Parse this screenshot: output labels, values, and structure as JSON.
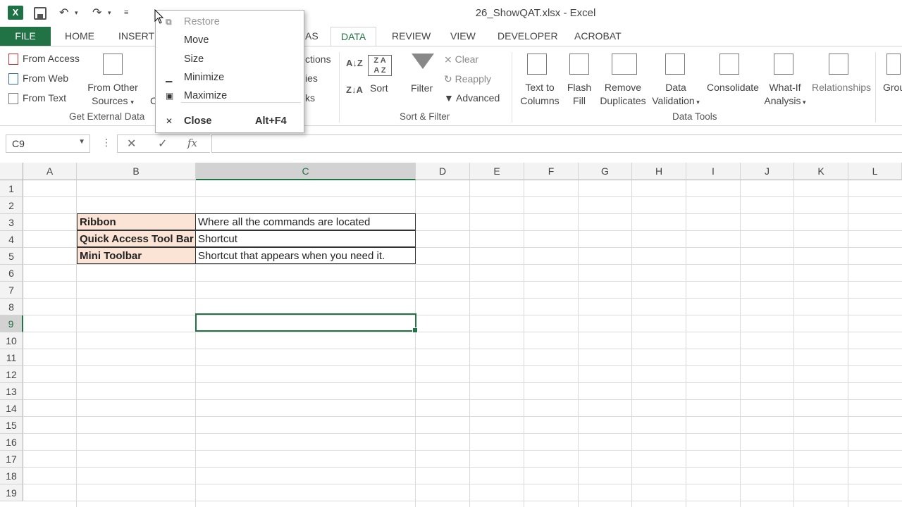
{
  "window": {
    "title": "26_ShowQAT.xlsx - Excel",
    "app_icon": "X"
  },
  "tabs": [
    {
      "label": "FILE"
    },
    {
      "label": "HOME"
    },
    {
      "label": "INSERT"
    },
    {
      "label": "AS"
    },
    {
      "label": "DATA"
    },
    {
      "label": "REVIEW"
    },
    {
      "label": "VIEW"
    },
    {
      "label": "DEVELOPER"
    },
    {
      "label": "ACROBAT"
    }
  ],
  "ribbon": {
    "get_external": {
      "from_access": "From Access",
      "from_web": "From Web",
      "from_text": "From Text",
      "from_other_1": "From Other",
      "from_other_2": "Sources",
      "partial_c": "C",
      "label": "Get External Data"
    },
    "connections": {
      "partial_1": "ctions",
      "partial_2": "ies",
      "partial_3": "ks"
    },
    "sort_filter": {
      "sort": "Sort",
      "filter": "Filter",
      "clear": "Clear",
      "reapply": "Reapply",
      "advanced": "Advanced",
      "label": "Sort & Filter"
    },
    "data_tools": {
      "text_to_1": "Text to",
      "text_to_2": "Columns",
      "flash_1": "Flash",
      "flash_2": "Fill",
      "remove_1": "Remove",
      "remove_2": "Duplicates",
      "validation_1": "Data",
      "validation_2": "Validation",
      "consolidate": "Consolidate",
      "whatif_1": "What-If",
      "whatif_2": "Analysis",
      "relationships": "Relationships",
      "group_partial": "Grou",
      "label": "Data Tools"
    }
  },
  "formula_bar": {
    "name_box": "C9",
    "cancel_glyph": "✕",
    "enter_glyph": "✓",
    "fx": "fx"
  },
  "columns": [
    "A",
    "B",
    "C",
    "D",
    "E",
    "F",
    "G",
    "H",
    "I",
    "J",
    "K",
    "L"
  ],
  "rows": [
    "1",
    "2",
    "3",
    "4",
    "5",
    "6",
    "7",
    "8",
    "9",
    "10",
    "11",
    "12",
    "13",
    "14",
    "15",
    "16",
    "17",
    "18",
    "19"
  ],
  "cells": [
    {
      "label": "Ribbon",
      "value": "Where all the commands are located"
    },
    {
      "label": "Quick Access Tool Bar",
      "value": "Shortcut"
    },
    {
      "label": "Mini Toolbar",
      "value": "Shortcut that appears when you need it."
    }
  ],
  "system_menu": {
    "restore": "Restore",
    "move": "Move",
    "size": "Size",
    "minimize": "Minimize",
    "maximize": "Maximize",
    "close": "Close",
    "close_shortcut": "Alt+F4"
  },
  "colors": {
    "excel_green": "#217346",
    "label_fill": "#fbe4d5"
  }
}
